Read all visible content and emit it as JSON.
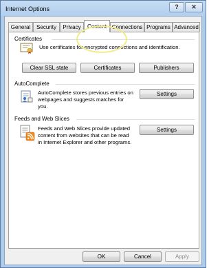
{
  "window": {
    "title": "Internet Options",
    "help_glyph": "?",
    "close_glyph": "✕"
  },
  "tabs": [
    {
      "label": "General"
    },
    {
      "label": "Security"
    },
    {
      "label": "Privacy"
    },
    {
      "label": "Content"
    },
    {
      "label": "Connections"
    },
    {
      "label": "Programs"
    },
    {
      "label": "Advanced"
    }
  ],
  "active_tab": "Content",
  "certificates": {
    "title": "Certificates",
    "description": "Use certificates for encrypted connections and identification.",
    "buttons": {
      "clear_ssl": "Clear SSL state",
      "certificates": "Certificates",
      "publishers": "Publishers"
    }
  },
  "autocomplete": {
    "title": "AutoComplete",
    "description": "AutoComplete stores previous entries on webpages and suggests matches for you.",
    "settings": "Settings"
  },
  "feeds": {
    "title": "Feeds and Web Slices",
    "description": "Feeds and Web Slices provide updated content from websites that can be read in Internet Explorer and other programs.",
    "settings": "Settings"
  },
  "footer": {
    "ok": "OK",
    "cancel": "Cancel",
    "apply": "Apply"
  },
  "colors": {
    "frame": "#aecbea",
    "highlight_ring": "#f1ec88",
    "rss_orange": "#f08a24"
  }
}
